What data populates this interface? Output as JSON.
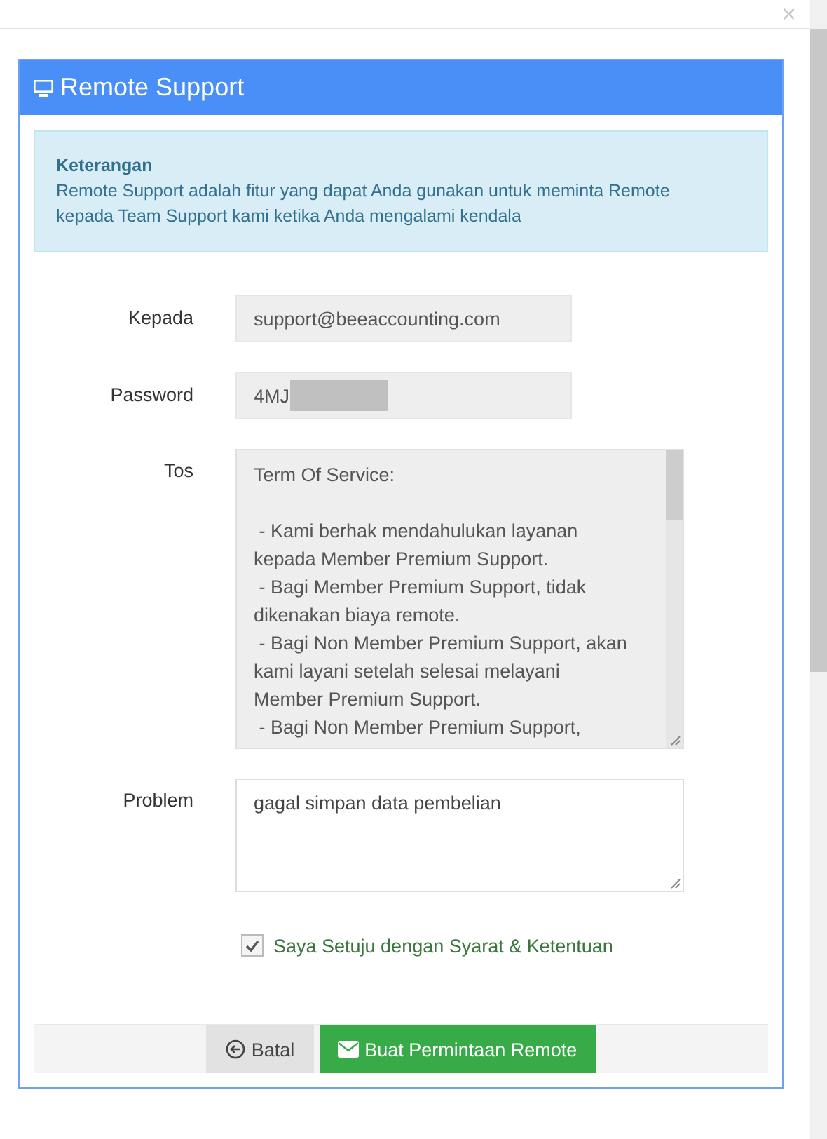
{
  "close_button": "×",
  "panel": {
    "title": "Remote Support"
  },
  "info": {
    "heading": "Keterangan",
    "text": "Remote Support adalah fitur yang dapat Anda gunakan untuk meminta Remote kepada Team Support kami ketika Anda mengalami kendala"
  },
  "fields": [
    {
      "kind": "input",
      "label": "Kepada",
      "value": "support@beeaccounting.com",
      "redacted": false
    },
    {
      "kind": "input",
      "label": "Password",
      "value": "4MJ",
      "redacted": true
    },
    {
      "kind": "tos",
      "label": "Tos",
      "heading": "Term Of Service:",
      "lines": [
        " - Kami berhak mendahulukan layanan",
        "kepada Member Premium Support.",
        " - Bagi Member Premium Support, tidak",
        "dikenakan biaya remote.",
        " - Bagi Non Member Premium Support, akan",
        "kami layani setelah selesai melayani",
        "Member Premium Support.",
        " - Bagi Non Member Premium Support,"
      ]
    },
    {
      "kind": "textarea",
      "label": "Problem",
      "value": "gagal simpan data pembelian"
    }
  ],
  "agree": {
    "label": "Saya Setuju dengan Syarat & Ketentuan",
    "checked": true
  },
  "buttons": [
    {
      "kind": "cancel",
      "label": "Batal"
    },
    {
      "kind": "submit",
      "label": "Buat Permintaan Remote"
    }
  ]
}
